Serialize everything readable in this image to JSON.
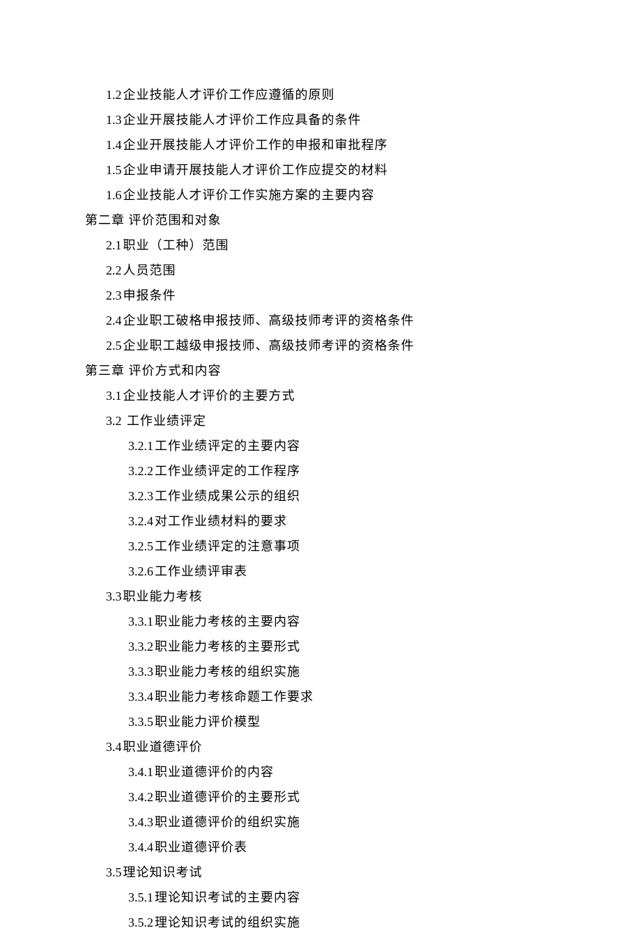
{
  "toc": [
    {
      "level": 1,
      "num": "1.2",
      "text": "企业技能人才评价工作应遵循的原则"
    },
    {
      "level": 1,
      "num": "1.3",
      "text": "企业开展技能人才评价工作应具备的条件"
    },
    {
      "level": 1,
      "num": "1.4",
      "text": "企业开展技能人才评价工作的申报和审批程序"
    },
    {
      "level": 1,
      "num": "1.5",
      "text": "企业申请开展技能人才评价工作应提交的材料"
    },
    {
      "level": 1,
      "num": "1.6",
      "text": "企业技能人才评价工作实施方案的主要内容"
    },
    {
      "level": 0,
      "num": "",
      "text": "第二章  评价范围和对象"
    },
    {
      "level": 1,
      "num": "2.1",
      "text": "职业（工种）范围"
    },
    {
      "level": 1,
      "num": "2.2",
      "text": "人员范围"
    },
    {
      "level": 1,
      "num": "2.3",
      "text": "申报条件"
    },
    {
      "level": 1,
      "num": "2.4",
      "text": "企业职工破格申报技师、高级技师考评的资格条件"
    },
    {
      "level": 1,
      "num": "2.5",
      "text": "企业职工越级申报技师、高级技师考评的资格条件"
    },
    {
      "level": 0,
      "num": "",
      "text": "第三章  评价方式和内容"
    },
    {
      "level": 1,
      "num": "3.1",
      "text": "企业技能人才评价的主要方式"
    },
    {
      "level": 1,
      "num": "3.2",
      "text": " 工作业绩评定"
    },
    {
      "level": 2,
      "num": "3.2.1",
      "text": "工作业绩评定的主要内容"
    },
    {
      "level": 2,
      "num": "3.2.2",
      "text": "工作业绩评定的工作程序"
    },
    {
      "level": 2,
      "num": "3.2.3",
      "text": "工作业绩成果公示的组织"
    },
    {
      "level": 2,
      "num": "3.2.4",
      "text": "对工作业绩材料的要求"
    },
    {
      "level": 2,
      "num": "3.2.5",
      "text": "工作业绩评定的注意事项"
    },
    {
      "level": 2,
      "num": "3.2.6",
      "text": "工作业绩评审表"
    },
    {
      "level": 1,
      "num": "3.3",
      "text": "职业能力考核"
    },
    {
      "level": 2,
      "num": "3.3.1",
      "text": "职业能力考核的主要内容"
    },
    {
      "level": 2,
      "num": "3.3.2",
      "text": "职业能力考核的主要形式"
    },
    {
      "level": 2,
      "num": "3.3.3",
      "text": "职业能力考核的组织实施"
    },
    {
      "level": 2,
      "num": "3.3.4",
      "text": "职业能力考核命题工作要求"
    },
    {
      "level": 2,
      "num": "3.3.5",
      "text": "职业能力评价模型"
    },
    {
      "level": 1,
      "num": "3.4",
      "text": "职业道德评价"
    },
    {
      "level": 2,
      "num": "3.4.1",
      "text": "职业道德评价的内容"
    },
    {
      "level": 2,
      "num": "3.4.2",
      "text": "职业道德评价的主要形式"
    },
    {
      "level": 2,
      "num": "3.4.3",
      "text": "职业道德评价的组织实施"
    },
    {
      "level": 2,
      "num": "3.4.4",
      "text": "职业道德评价表"
    },
    {
      "level": 1,
      "num": "3.5",
      "text": "理论知识考试"
    },
    {
      "level": 2,
      "num": "3.5.1",
      "text": "理论知识考试的主要内容"
    },
    {
      "level": 2,
      "num": "3.5.2",
      "text": "理论知识考试的组织实施"
    }
  ]
}
